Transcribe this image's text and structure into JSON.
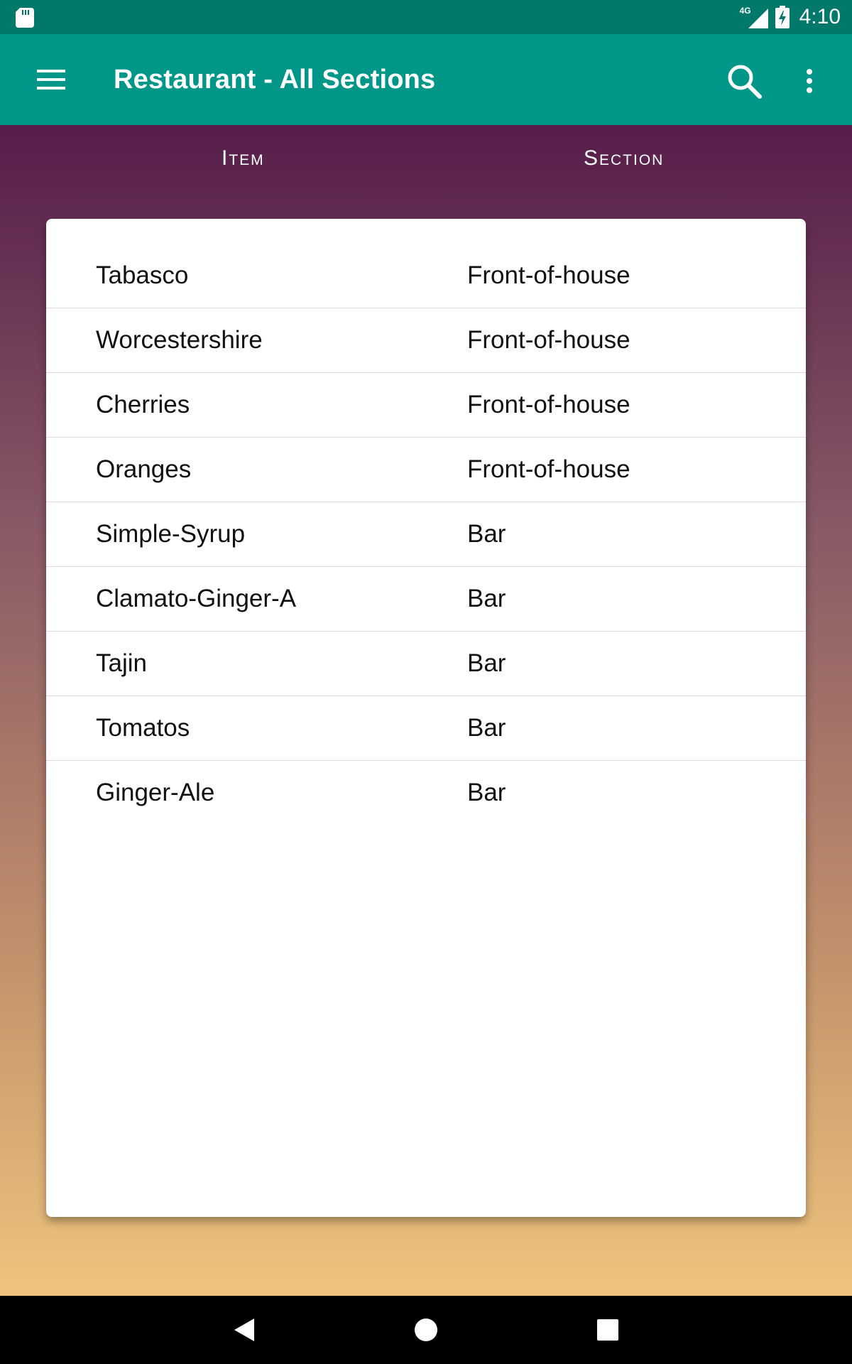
{
  "status_bar": {
    "time": "4:10",
    "network": "4G",
    "icons": [
      "sd-card-icon",
      "signal-icon",
      "battery-charging-icon"
    ]
  },
  "app_bar": {
    "title": "Restaurant - All Sections",
    "icons": [
      "menu-icon",
      "search-icon",
      "more-vert-icon"
    ]
  },
  "columns": {
    "item_label": "Item",
    "section_label": "Section"
  },
  "rows": [
    {
      "item": "Tabasco",
      "section": "Front-of-house"
    },
    {
      "item": "Worcestershire",
      "section": "Front-of-house"
    },
    {
      "item": "Cherries",
      "section": "Front-of-house"
    },
    {
      "item": "Oranges",
      "section": "Front-of-house"
    },
    {
      "item": "Simple-Syrup",
      "section": "Bar"
    },
    {
      "item": "Clamato-Ginger-A",
      "section": "Bar"
    },
    {
      "item": "Tajin",
      "section": "Bar"
    },
    {
      "item": "Tomatos",
      "section": "Bar"
    },
    {
      "item": "Ginger-Ale",
      "section": "Bar"
    }
  ],
  "nav_bar": {
    "icons": [
      "back-icon",
      "home-icon",
      "recents-icon"
    ]
  },
  "colors": {
    "status_bar": "#00796b",
    "app_bar": "#009688",
    "gradient_top": "#561d4a",
    "gradient_bottom": "#eec47c"
  }
}
